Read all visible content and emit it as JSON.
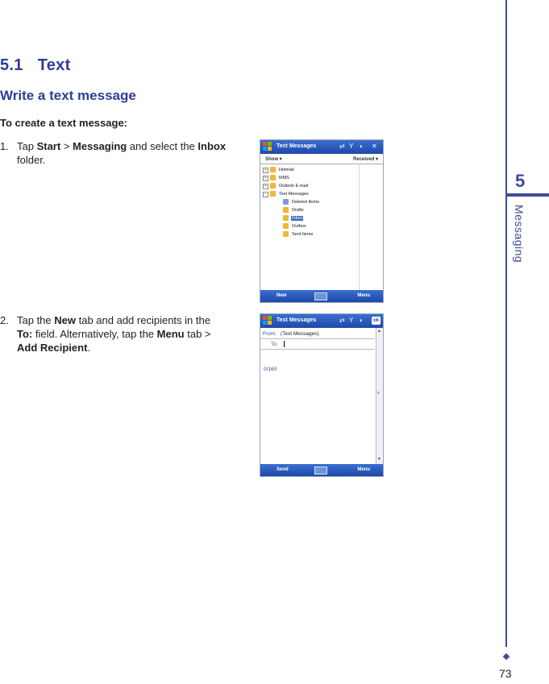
{
  "section": {
    "number": "5.1",
    "title": "Text"
  },
  "subsection": {
    "title": "Write a text message"
  },
  "lead": "To create a text message:",
  "steps": [
    {
      "n": "1.",
      "parts": [
        "Tap ",
        "Start",
        " > ",
        "Messaging",
        " and select the ",
        "Inbox",
        " folder."
      ]
    },
    {
      "n": "2.",
      "parts": [
        "Tap the ",
        "New",
        " tab and add recipients in the ",
        "To:",
        " field. Alternatively, tap the ",
        "Menu",
        " tab > ",
        "Add Recipient",
        "."
      ]
    }
  ],
  "chapter": {
    "number": "5",
    "name": "Messaging"
  },
  "page_number": "73",
  "screen1": {
    "title": "Text Messages",
    "menu_left": "Show ▾",
    "menu_right": "Received ▾",
    "folders": [
      {
        "label": "Hotmail",
        "expander": "+",
        "level": 0
      },
      {
        "label": "MMS",
        "expander": "+",
        "level": 0
      },
      {
        "label": "Outlook E-mail",
        "expander": "+",
        "level": 0
      },
      {
        "label": "Text Messages",
        "expander": "−",
        "level": 0
      },
      {
        "label": "Deleted Items",
        "expander": "",
        "level": 1
      },
      {
        "label": "Drafts",
        "expander": "",
        "level": 1
      },
      {
        "label": "Inbox",
        "expander": "",
        "level": 1,
        "selected": true
      },
      {
        "label": "Outbox",
        "expander": "",
        "level": 1
      },
      {
        "label": "Sent Items",
        "expander": "",
        "level": 1
      }
    ],
    "softkey_left": "New",
    "softkey_right": "Menu"
  },
  "screen2": {
    "title": "Text Messages",
    "from_label": "From:",
    "from_value": "(Text Messages)",
    "to_label": "To:",
    "counter": "0/160",
    "ok_label": "ok",
    "softkey_left": "Send",
    "softkey_right": "Menu"
  },
  "colors": {
    "heading": "#2e3d98",
    "rail": "#3d4b9c",
    "titlebar": "#1f48a8",
    "selection": "#316ac5"
  }
}
